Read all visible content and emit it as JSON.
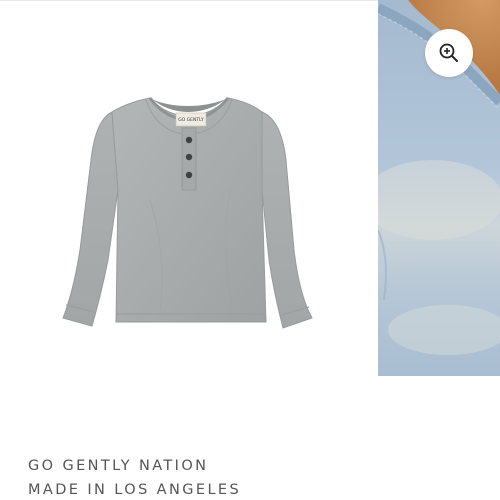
{
  "gallery": {
    "zoom_icon": "zoom-in-icon",
    "shirt_tag_text": "GO GENTLY",
    "colors": {
      "shirt": "#a9adad",
      "denim": "#a9bfd4"
    }
  },
  "brand": {
    "line1": "GO GENTLY NATION",
    "line2": "MADE IN LOS ANGELES"
  }
}
